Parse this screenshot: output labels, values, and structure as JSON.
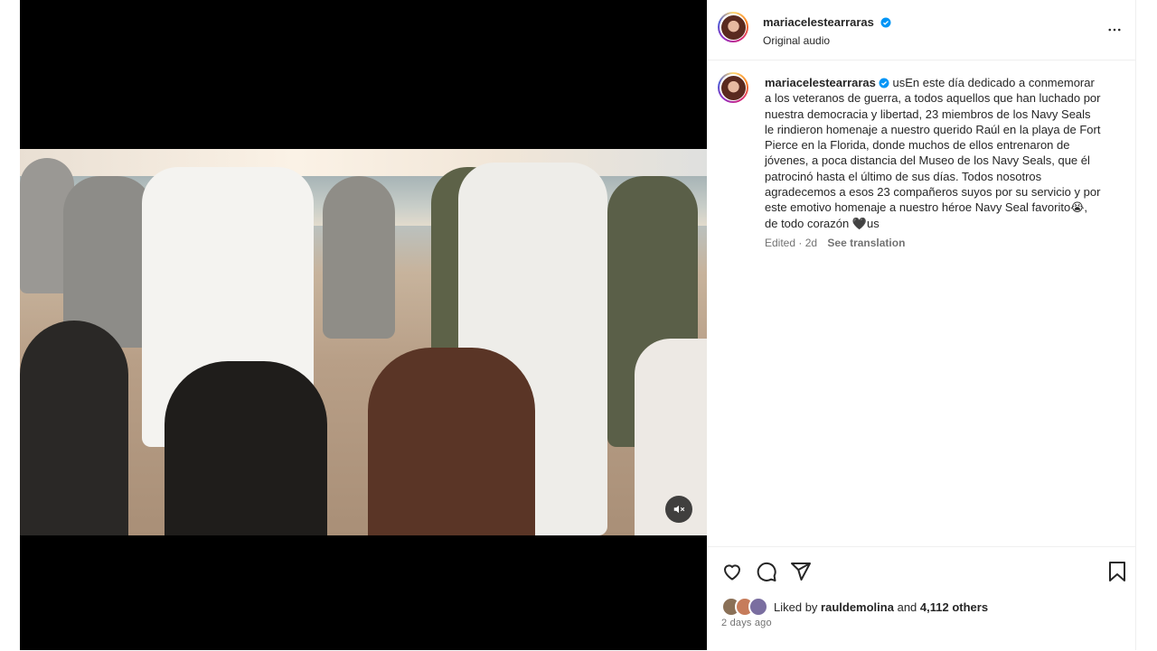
{
  "post": {
    "username": "mariacelestearraras",
    "audio": "Original audio",
    "caption_user": "mariacelestearraras",
    "caption_text": "usEn este día dedicado a conmemorar a los veteranos de guerra, a todos aquellos que han luchado por nuestra democracia y libertad, 23 miembros de los Navy Seals le rindieron homenaje a nuestro querido Raúl en la playa de Fort Pierce  en la Florida, donde muchos de ellos entrenaron de jóvenes, a poca distancia del Museo de los Navy Seals, que él patrocinó hasta el último de sus días. Todos nosotros agradecemos a esos 23 compañeros suyos por su servicio y por este emotivo homenaje a nuestro héroe Navy Seal favorito😭, de todo corazón 🖤us",
    "edited": "Edited · 2d",
    "see_translation": "See translation",
    "liked_by_prefix": "Liked by",
    "liked_by_user": "rauldemolina",
    "and_text": "and",
    "others": "4,112 others",
    "time_ago": "2 days ago"
  },
  "icons": {
    "verified": "verified-badge-icon",
    "more": "more-options-icon",
    "mute": "muted-speaker-icon",
    "like": "heart-icon",
    "comment": "comment-icon",
    "share": "paper-plane-icon",
    "save": "bookmark-icon"
  },
  "colors": {
    "verified": "#0095f6",
    "text": "#262626",
    "secondary": "#737373",
    "divider": "#efefef"
  }
}
